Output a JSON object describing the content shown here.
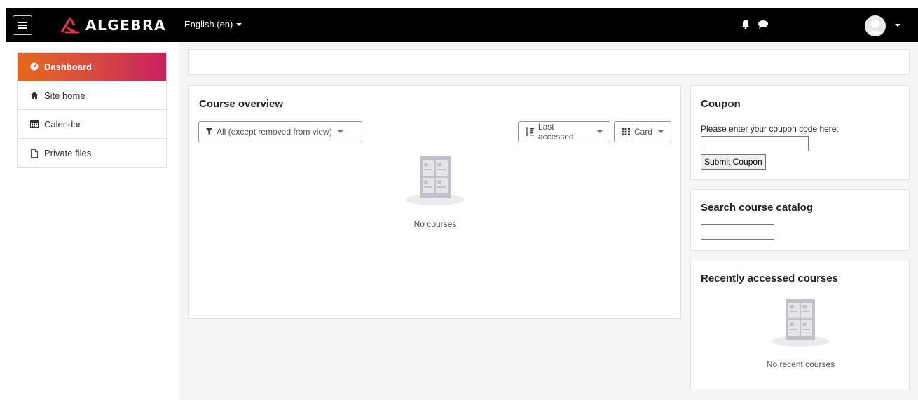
{
  "navbar": {
    "brand_name": "ALGEBRA",
    "language": "English (en)",
    "icons": [
      "menu-icon",
      "bell-icon",
      "chat-icon",
      "user-avatar"
    ]
  },
  "sidebar": {
    "items": [
      {
        "label": "Dashboard",
        "icon": "dashboard-icon",
        "active": true
      },
      {
        "label": "Site home",
        "icon": "home-icon",
        "active": false
      },
      {
        "label": "Calendar",
        "icon": "calendar-icon",
        "active": false
      },
      {
        "label": "Private files",
        "icon": "file-icon",
        "active": false
      }
    ]
  },
  "course_overview": {
    "title": "Course overview",
    "filter_label": "All (except removed from view)",
    "sort_label": "Last accessed",
    "view_label": "Card",
    "empty_text": "No courses"
  },
  "coupon": {
    "title": "Coupon",
    "prompt": "Please enter your coupon code here:",
    "code_value": "",
    "submit_label": "Submit Coupon"
  },
  "search_catalog": {
    "title": "Search course catalog",
    "query_value": ""
  },
  "recent_courses": {
    "title": "Recently accessed courses",
    "empty_text": "No recent courses"
  },
  "colors": {
    "accent_start": "#e2691e",
    "accent_end": "#c8205f",
    "navbar_bg": "#000000",
    "page_bg": "#f5f5f5"
  }
}
